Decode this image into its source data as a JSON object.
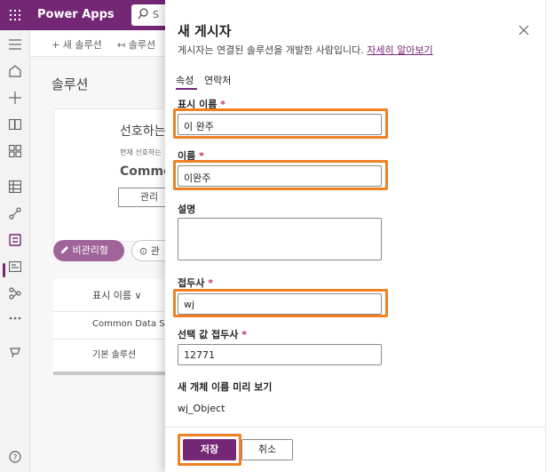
{
  "app": {
    "title": "Power Apps",
    "search_placeholder": "S",
    "brand_color": "#742774",
    "highlight_color": "#f08022"
  },
  "nav_icons": [
    "menu-icon",
    "home-icon",
    "plus-icon",
    "learn-icon",
    "apps-icon",
    "table-icon",
    "flows-icon",
    "solutions-icon",
    "cards-icon",
    "dataflow-icon",
    "more-icon",
    "chatbot-icon",
    "help-icon"
  ],
  "background": {
    "commands": [
      "+ 새 솔루션",
      "↤ 솔루션"
    ],
    "page_title": "솔루션",
    "card": {
      "heading": "선호하는",
      "sub": "현재 선호하는",
      "publisher": "Common",
      "manage_button": "관리"
    },
    "pills": [
      "비관리형",
      "관"
    ],
    "table": {
      "header": "표시 이름 ∨",
      "rows": [
        "Common Data S",
        "기본 솔루션"
      ]
    }
  },
  "panel": {
    "title": "새 게시자",
    "description": "게시자는 연결된 솔루션을 개발한 사람입니다.",
    "learn_more": "자세히 알아보기",
    "tabs": [
      "속성",
      "연락처"
    ],
    "fields": {
      "display_name": {
        "label": "표시 이름",
        "value": "이 완주"
      },
      "name": {
        "label": "이름",
        "value": "이완주"
      },
      "description": {
        "label": "설명",
        "value": ""
      },
      "prefix": {
        "label": "접두사",
        "value": "wj"
      },
      "option_prefix": {
        "label": "선택 값 접두사",
        "value": "12771"
      }
    },
    "preview_label": "새 개체 이름 미리 보기",
    "preview_value": "wj_Object",
    "required_marker": "*",
    "save_label": "저장",
    "cancel_label": "취소"
  }
}
